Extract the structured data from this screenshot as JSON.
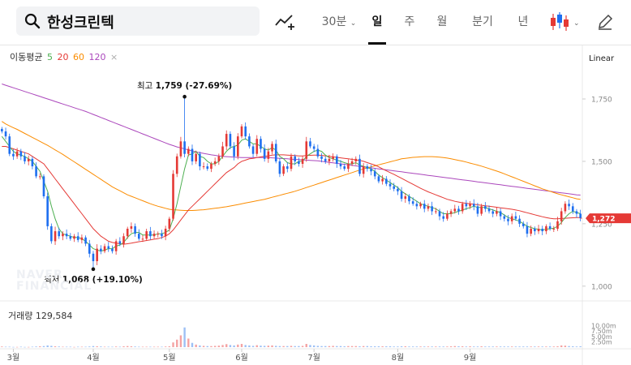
{
  "search": {
    "query": "한성크린텍"
  },
  "toolbar": {
    "interval": "30분",
    "tabs": [
      "일",
      "주",
      "월",
      "분기",
      "년"
    ],
    "selected_tab": "일"
  },
  "indicator": {
    "label": "이동평균",
    "periods": [
      {
        "label": "5",
        "color": "#4caf50"
      },
      {
        "label": "20",
        "color": "#e53935"
      },
      {
        "label": "60",
        "color": "#fb8c00"
      },
      {
        "label": "120",
        "color": "#ab47bc"
      }
    ],
    "close_mark": "×"
  },
  "scale_mode": "Linear",
  "watermark": [
    "NAVER",
    "FINANCIAL"
  ],
  "volume": {
    "label": "거래량",
    "value": "129,584",
    "ticks": [
      "10.00m",
      "7.50m",
      "5.00m",
      "2.50m"
    ]
  },
  "chart_data": {
    "type": "candlestick",
    "y_ticks": [
      1000,
      1250,
      1500,
      1750
    ],
    "y_tick_labels": [
      "1,000",
      "1,250",
      "1,500",
      "1,750"
    ],
    "ylim": [
      970,
      1880
    ],
    "x_ticks": [
      {
        "label": "3월",
        "idx": 3
      },
      {
        "label": "4월",
        "idx": 24
      },
      {
        "label": "5월",
        "idx": 44
      },
      {
        "label": "6월",
        "idx": 63
      },
      {
        "label": "7월",
        "idx": 82
      },
      {
        "label": "8월",
        "idx": 104
      },
      {
        "label": "9월",
        "idx": 123
      }
    ],
    "current_price": {
      "value": 1272,
      "label": "1,272",
      "color": "#e53935"
    },
    "annotations": [
      {
        "label": "최고",
        "text": "1,759 (-27.69%)",
        "idx": 48,
        "value": 1759
      },
      {
        "label": "최저",
        "text": "1,068 (+19.10%)",
        "idx": 24,
        "value": 1068
      }
    ],
    "up_color": "#e53935",
    "down_color": "#1e6ff0",
    "close": [
      1620,
      1600,
      1530,
      1520,
      1540,
      1520,
      1500,
      1510,
      1480,
      1440,
      1440,
      1360,
      1240,
      1180,
      1220,
      1200,
      1210,
      1200,
      1190,
      1200,
      1185,
      1195,
      1170,
      1130,
      1100,
      1150,
      1140,
      1160,
      1150,
      1140,
      1180,
      1170,
      1200,
      1230,
      1240,
      1210,
      1190,
      1190,
      1220,
      1200,
      1210,
      1210,
      1200,
      1230,
      1270,
      1450,
      1520,
      1580,
      1530,
      1550,
      1500,
      1530,
      1480,
      1480,
      1470,
      1490,
      1500,
      1520,
      1560,
      1610,
      1560,
      1520,
      1600,
      1640,
      1600,
      1560,
      1530,
      1590,
      1550,
      1510,
      1540,
      1570,
      1500,
      1450,
      1480,
      1470,
      1520,
      1500,
      1490,
      1510,
      1580,
      1560,
      1550,
      1520,
      1510,
      1500,
      1510,
      1520,
      1490,
      1480,
      1470,
      1490,
      1500,
      1510,
      1450,
      1480,
      1470,
      1460,
      1440,
      1420,
      1430,
      1410,
      1400,
      1390,
      1380,
      1350,
      1360,
      1340,
      1330,
      1320,
      1330,
      1310,
      1320,
      1300,
      1300,
      1280,
      1270,
      1290,
      1300,
      1310,
      1300,
      1330,
      1320,
      1330,
      1320,
      1290,
      1320,
      1310,
      1300,
      1290,
      1300,
      1280,
      1270,
      1260,
      1280,
      1270,
      1250,
      1240,
      1210,
      1230,
      1220,
      1230,
      1220,
      1240,
      1230,
      1230,
      1260,
      1300,
      1330,
      1320,
      1300,
      1290,
      1272
    ],
    "ma5": [
      1600,
      1580,
      1560,
      1540,
      1530,
      1525,
      1520,
      1510,
      1500,
      1480,
      1460,
      1420,
      1380,
      1320,
      1270,
      1230,
      1210,
      1205,
      1200,
      1195,
      1195,
      1190,
      1180,
      1165,
      1150,
      1145,
      1140,
      1145,
      1150,
      1150,
      1160,
      1165,
      1175,
      1195,
      1210,
      1215,
      1215,
      1205,
      1205,
      1205,
      1205,
      1210,
      1210,
      1215,
      1225,
      1270,
      1330,
      1400,
      1470,
      1525,
      1530,
      1540,
      1520,
      1515,
      1500,
      1490,
      1490,
      1500,
      1520,
      1540,
      1555,
      1560,
      1565,
      1585,
      1590,
      1580,
      1570,
      1570,
      1560,
      1550,
      1545,
      1555,
      1545,
      1520,
      1510,
      1495,
      1490,
      1490,
      1500,
      1500,
      1520,
      1530,
      1540,
      1545,
      1540,
      1525,
      1515,
      1510,
      1505,
      1500,
      1495,
      1490,
      1490,
      1495,
      1485,
      1480,
      1475,
      1470,
      1460,
      1445,
      1435,
      1425,
      1415,
      1405,
      1395,
      1380,
      1370,
      1360,
      1350,
      1340,
      1330,
      1325,
      1320,
      1315,
      1310,
      1300,
      1290,
      1290,
      1290,
      1295,
      1300,
      1305,
      1310,
      1315,
      1320,
      1315,
      1315,
      1315,
      1310,
      1305,
      1300,
      1295,
      1285,
      1275,
      1270,
      1265,
      1260,
      1250,
      1240,
      1235,
      1230,
      1228,
      1225,
      1228,
      1230,
      1232,
      1240,
      1255,
      1275,
      1290,
      1300,
      1295,
      1290
    ],
    "ma20": [
      1560,
      1560,
      1555,
      1550,
      1545,
      1540,
      1535,
      1530,
      1520,
      1510,
      1500,
      1490,
      1470,
      1450,
      1430,
      1410,
      1390,
      1370,
      1350,
      1330,
      1310,
      1290,
      1270,
      1250,
      1230,
      1215,
      1200,
      1190,
      1180,
      1175,
      1172,
      1170,
      1168,
      1170,
      1172,
      1175,
      1178,
      1180,
      1183,
      1185,
      1188,
      1190,
      1195,
      1200,
      1210,
      1225,
      1245,
      1265,
      1285,
      1305,
      1320,
      1335,
      1350,
      1365,
      1380,
      1395,
      1410,
      1425,
      1440,
      1455,
      1465,
      1475,
      1490,
      1500,
      1505,
      1510,
      1512,
      1515,
      1518,
      1520,
      1522,
      1525,
      1526,
      1526,
      1526,
      1525,
      1524,
      1523,
      1522,
      1522,
      1523,
      1524,
      1525,
      1525,
      1524,
      1522,
      1520,
      1518,
      1516,
      1514,
      1512,
      1510,
      1508,
      1506,
      1504,
      1500,
      1495,
      1490,
      1485,
      1478,
      1470,
      1462,
      1455,
      1448,
      1440,
      1432,
      1424,
      1416,
      1408,
      1400,
      1392,
      1385,
      1378,
      1372,
      1366,
      1360,
      1354,
      1348,
      1344,
      1340,
      1337,
      1334,
      1332,
      1330,
      1328,
      1326,
      1324,
      1322,
      1320,
      1318,
      1316,
      1314,
      1312,
      1310,
      1308,
      1305,
      1302,
      1298,
      1294,
      1290,
      1286,
      1282,
      1278,
      1275,
      1272,
      1270,
      1270,
      1271,
      1272,
      1273,
      1274,
      1275,
      1275
    ],
    "ma60": [
      1660,
      1650,
      1642,
      1635,
      1628,
      1620,
      1612,
      1604,
      1596,
      1588,
      1580,
      1572,
      1564,
      1555,
      1546,
      1537,
      1528,
      1518,
      1508,
      1498,
      1488,
      1478,
      1468,
      1458,
      1448,
      1438,
      1428,
      1418,
      1408,
      1398,
      1390,
      1382,
      1374,
      1366,
      1360,
      1354,
      1348,
      1342,
      1336,
      1330,
      1325,
      1320,
      1316,
      1312,
      1308,
      1306,
      1305,
      1304,
      1303,
      1303,
      1303,
      1304,
      1305,
      1306,
      1308,
      1310,
      1312,
      1314,
      1316,
      1318,
      1321,
      1324,
      1327,
      1330,
      1333,
      1336,
      1339,
      1342,
      1345,
      1348,
      1352,
      1356,
      1360,
      1364,
      1368,
      1372,
      1376,
      1380,
      1385,
      1390,
      1395,
      1400,
      1405,
      1410,
      1415,
      1420,
      1425,
      1430,
      1435,
      1440,
      1445,
      1450,
      1455,
      1460,
      1465,
      1470,
      1474,
      1478,
      1482,
      1486,
      1490,
      1494,
      1498,
      1502,
      1506,
      1510,
      1512,
      1514,
      1516,
      1517,
      1518,
      1519,
      1519,
      1519,
      1518,
      1517,
      1515,
      1513,
      1510,
      1507,
      1504,
      1501,
      1497,
      1493,
      1489,
      1485,
      1481,
      1476,
      1471,
      1466,
      1461,
      1456,
      1450,
      1444,
      1438,
      1432,
      1426,
      1420,
      1414,
      1408,
      1402,
      1396,
      1390,
      1385,
      1380,
      1375,
      1370,
      1366,
      1362,
      1358,
      1354,
      1350,
      1348
    ],
    "ma120": [
      1810,
      1805,
      1800,
      1795,
      1790,
      1785,
      1780,
      1775,
      1770,
      1765,
      1760,
      1755,
      1750,
      1745,
      1740,
      1735,
      1730,
      1725,
      1720,
      1715,
      1710,
      1705,
      1700,
      1694,
      1688,
      1682,
      1676,
      1670,
      1664,
      1658,
      1652,
      1646,
      1640,
      1634,
      1628,
      1622,
      1616,
      1610,
      1604,
      1598,
      1592,
      1586,
      1580,
      1574,
      1568,
      1563,
      1558,
      1554,
      1550,
      1546,
      1542,
      1538,
      1535,
      1532,
      1529,
      1526,
      1524,
      1522,
      1520,
      1519,
      1518,
      1517,
      1516,
      1515,
      1515,
      1515,
      1515,
      1515,
      1515,
      1515,
      1515,
      1514,
      1513,
      1512,
      1511,
      1510,
      1509,
      1508,
      1507,
      1506,
      1505,
      1504,
      1503,
      1502,
      1500,
      1498,
      1496,
      1494,
      1492,
      1490,
      1488,
      1486,
      1484,
      1482,
      1480,
      1478,
      1476,
      1474,
      1472,
      1470,
      1468,
      1466,
      1464,
      1462,
      1460,
      1458,
      1456,
      1454,
      1452,
      1450,
      1448,
      1446,
      1444,
      1442,
      1440,
      1438,
      1436,
      1434,
      1432,
      1430,
      1428,
      1426,
      1424,
      1422,
      1420,
      1418,
      1416,
      1414,
      1412,
      1410,
      1408,
      1406,
      1404,
      1402,
      1400,
      1398,
      1396,
      1394,
      1392,
      1390,
      1388,
      1386,
      1384,
      1382,
      1380,
      1378,
      1376,
      1374,
      1372,
      1370,
      1368,
      1366,
      1365
    ],
    "volume": [
      0.3,
      0.2,
      0.2,
      0.1,
      0.1,
      0.2,
      0.1,
      0.1,
      0.2,
      0.3,
      0.4,
      0.5,
      0.8,
      0.6,
      0.4,
      0.3,
      0.2,
      0.2,
      0.2,
      0.1,
      0.2,
      0.2,
      0.2,
      0.3,
      0.5,
      0.4,
      0.3,
      0.2,
      0.2,
      0.2,
      0.3,
      0.2,
      0.4,
      0.5,
      0.4,
      0.3,
      0.2,
      0.2,
      0.2,
      0.2,
      0.2,
      0.2,
      0.2,
      0.3,
      0.4,
      2.2,
      3.5,
      5.5,
      9.2,
      4.0,
      2.0,
      1.2,
      0.8,
      0.6,
      0.5,
      0.5,
      0.6,
      0.7,
      1.0,
      1.4,
      1.0,
      0.8,
      1.2,
      1.5,
      1.0,
      0.8,
      0.6,
      0.9,
      0.7,
      0.6,
      0.7,
      0.8,
      0.6,
      0.5,
      0.5,
      0.5,
      0.6,
      0.5,
      0.5,
      0.6,
      1.5,
      1.0,
      0.8,
      0.6,
      0.5,
      0.5,
      0.5,
      0.6,
      0.5,
      0.5,
      0.4,
      0.5,
      0.5,
      0.5,
      0.4,
      0.5,
      0.5,
      0.4,
      0.4,
      0.4,
      0.4,
      0.4,
      0.4,
      0.3,
      0.3,
      0.4,
      0.4,
      0.3,
      0.3,
      0.3,
      0.3,
      0.3,
      0.3,
      0.3,
      0.3,
      0.3,
      0.3,
      0.3,
      0.4,
      0.5,
      0.4,
      0.4,
      0.3,
      0.4,
      0.3,
      0.3,
      0.4,
      0.3,
      0.3,
      0.3,
      0.3,
      0.3,
      0.3,
      0.3,
      0.3,
      0.3,
      0.3,
      0.3,
      0.3,
      0.3,
      0.3,
      0.3,
      0.3,
      0.3,
      0.3,
      0.3,
      0.4,
      0.8,
      0.7,
      0.5,
      0.4,
      0.3,
      0.4
    ]
  }
}
